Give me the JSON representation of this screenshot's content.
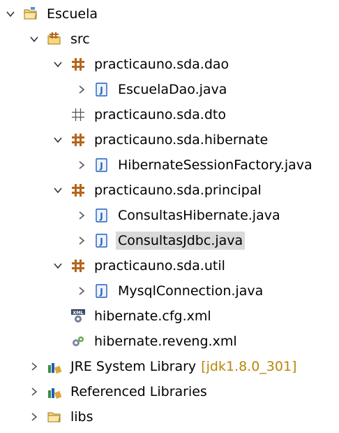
{
  "tree": [
    {
      "label": "Escuela",
      "icon": "project-icon",
      "chevron": "expanded",
      "depth": 0
    },
    {
      "label": "src",
      "icon": "source-folder-icon",
      "chevron": "expanded",
      "depth": 1
    },
    {
      "label": "practicauno.sda.dao",
      "icon": "package-icon",
      "chevron": "expanded",
      "depth": 2
    },
    {
      "label": "EscuelaDao.java",
      "icon": "java-file-icon",
      "chevron": "collapsed",
      "depth": 3
    },
    {
      "label": "practicauno.sda.dto",
      "icon": "empty-package-icon",
      "chevron": "none",
      "depth": 2
    },
    {
      "label": "practicauno.sda.hibernate",
      "icon": "package-icon",
      "chevron": "expanded",
      "depth": 2
    },
    {
      "label": "HibernateSessionFactory.java",
      "icon": "java-file-icon",
      "chevron": "collapsed",
      "depth": 3
    },
    {
      "label": "practicauno.sda.principal",
      "icon": "package-icon",
      "chevron": "expanded",
      "depth": 2
    },
    {
      "label": "ConsultasHibernate.java",
      "icon": "java-file-icon",
      "chevron": "collapsed",
      "depth": 3
    },
    {
      "label": "ConsultasJdbc.java",
      "icon": "java-file-icon",
      "chevron": "collapsed",
      "depth": 3,
      "selected": true
    },
    {
      "label": "practicauno.sda.util",
      "icon": "package-icon",
      "chevron": "expanded",
      "depth": 2
    },
    {
      "label": "MysqlConnection.java",
      "icon": "java-file-icon",
      "chevron": "collapsed",
      "depth": 3
    },
    {
      "label": "hibernate.cfg.xml",
      "icon": "xml-file-icon",
      "chevron": "none",
      "depth": 2
    },
    {
      "label": "hibernate.reveng.xml",
      "icon": "reveng-file-icon",
      "chevron": "none",
      "depth": 2
    },
    {
      "label": "JRE System Library",
      "decoration": "[jdk1.8.0_301]",
      "icon": "library-icon",
      "chevron": "collapsed",
      "depth": 1
    },
    {
      "label": "Referenced Libraries",
      "icon": "library-icon",
      "chevron": "collapsed",
      "depth": 1
    },
    {
      "label": "libs",
      "icon": "folder-icon",
      "chevron": "collapsed",
      "depth": 1
    }
  ],
  "colors": {
    "selection": "#d9d9d9",
    "decoration": "#b8860b",
    "package": "#b5651d",
    "java": "#1f5fbf"
  }
}
